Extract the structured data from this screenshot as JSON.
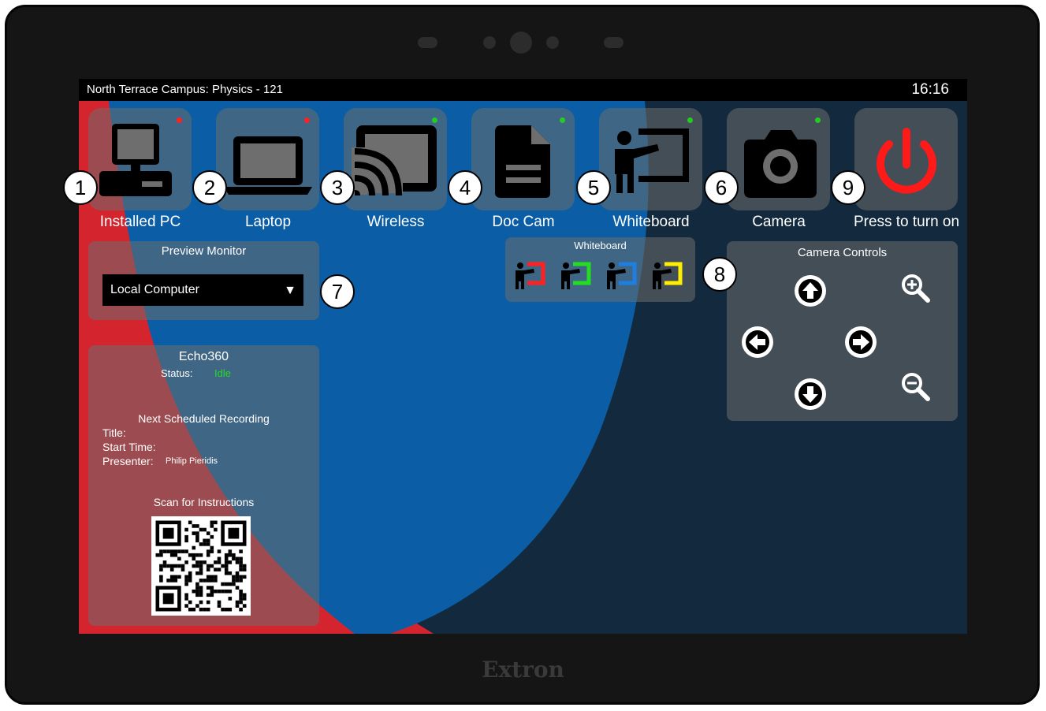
{
  "device": {
    "brand": "Extron"
  },
  "header": {
    "room": "North Terrace Campus: Physics - 121",
    "time": "16:16"
  },
  "sources": [
    {
      "label": "Installed PC",
      "icon": "desktop-pc-icon",
      "status_color": "#ff2020"
    },
    {
      "label": "Laptop",
      "icon": "laptop-icon",
      "status_color": "#ff2020"
    },
    {
      "label": "Wireless",
      "icon": "cast-icon",
      "status_color": "#22cc22"
    },
    {
      "label": "Doc Cam",
      "icon": "document-icon",
      "status_color": "#22cc22"
    },
    {
      "label": "Whiteboard",
      "icon": "presenter-icon",
      "status_color": "#22cc22"
    },
    {
      "label": "Camera",
      "icon": "camera-icon",
      "status_color": "#22cc22"
    },
    {
      "label": "Press to turn on",
      "icon": "power-icon",
      "power_color": "#ff1a1a"
    }
  ],
  "preview": {
    "title": "Preview Monitor",
    "selected": "Local Computer"
  },
  "echo": {
    "title": "Echo360",
    "status_label": "Status:",
    "status_value": "Idle",
    "status_color": "#22dd22",
    "next_title": "Next Scheduled Recording",
    "title_label": "Title:",
    "start_label": "Start Time:",
    "presenter_label": "Presenter:",
    "presenter_value": "Philip Pieridis",
    "scan_label": "Scan for Instructions"
  },
  "whiteboard": {
    "title": "Whiteboard",
    "colors": [
      "#ff2020",
      "#22dd22",
      "#1e7fe0",
      "#ffee00"
    ]
  },
  "camera_controls": {
    "title": "Camera Controls",
    "buttons": [
      "up-arrow-icon",
      "left-arrow-icon",
      "right-arrow-icon",
      "down-arrow-icon",
      "zoom-in-icon",
      "zoom-out-icon"
    ]
  },
  "callouts": [
    "1",
    "2",
    "3",
    "4",
    "5",
    "6",
    "9",
    "7",
    "8"
  ],
  "theme": {
    "red": "#d4252e",
    "blue": "#0b5ea5",
    "navy": "#13293d"
  }
}
